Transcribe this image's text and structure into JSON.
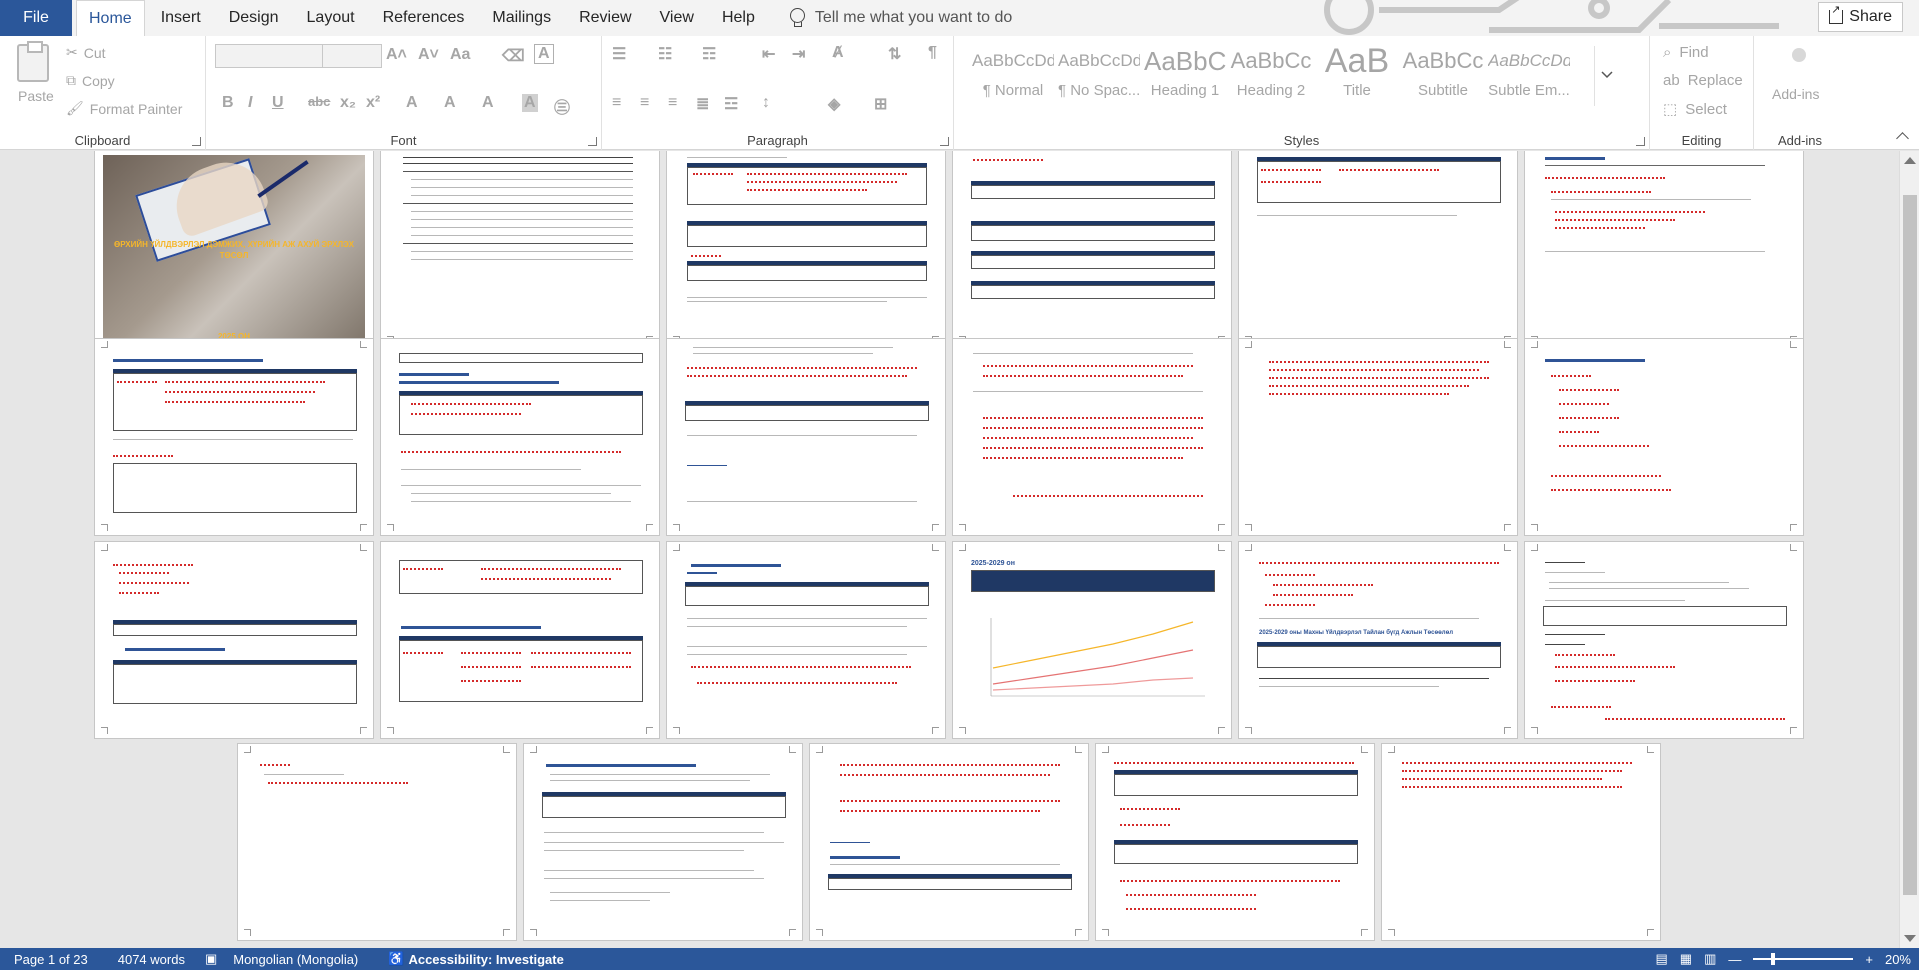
{
  "tabs": {
    "file": "File",
    "items": [
      "Home",
      "Insert",
      "Design",
      "Layout",
      "References",
      "Mailings",
      "Review",
      "View",
      "Help"
    ],
    "active": "Home",
    "tellme_placeholder": "Tell me what you want to do",
    "share": "Share"
  },
  "ribbon": {
    "clipboard": {
      "label": "Clipboard",
      "paste": "Paste",
      "cut": "Cut",
      "copy": "Copy",
      "format_painter": "Format Painter"
    },
    "font": {
      "label": "Font"
    },
    "paragraph": {
      "label": "Paragraph"
    },
    "styles": {
      "label": "Styles",
      "items": [
        {
          "sample": "AaBbCcDd",
          "name": "¶ Normal"
        },
        {
          "sample": "AaBbCcDd",
          "name": "¶ No Spac..."
        },
        {
          "sample": "AaBbC(",
          "name": "Heading 1"
        },
        {
          "sample": "AaBbCc",
          "name": "Heading 2"
        },
        {
          "sample": "AaB",
          "name": "Title"
        },
        {
          "sample": "AaBbCc",
          "name": "Subtitle"
        },
        {
          "sample": "AaBbCcDd",
          "name": "Subtle Em..."
        }
      ]
    },
    "editing": {
      "label": "Editing",
      "find": "Find",
      "replace": "Replace",
      "select": "Select"
    },
    "addins": {
      "label": "Add-ins",
      "button": "Add-ins"
    }
  },
  "document": {
    "cover_title": "ӨРХИЙН ҮЙЛДВЭРЛЭЛ ДЭМЖИХ, ХҮРИЙН АЖ АХУЙ ЭРХЛЭХ ТӨСӨЛ",
    "cover_year": "2025 ОН",
    "chart_caption": "2025-2029 он",
    "table_caption": "2025-2029 оны Махны Үйлдвэрлэл Тайлан бүгд Ажлын Төсөөлөл"
  },
  "statusbar": {
    "page": "Page 1 of 23",
    "words": "4074 words",
    "language": "Mongolian (Mongolia)",
    "accessibility": "Accessibility: Investigate",
    "zoom": "20%"
  },
  "colors": {
    "brand": "#2b579a",
    "table_header": "#1f3864",
    "spell_error": "#d42a2a",
    "cover_accent": "#f5b62a"
  }
}
